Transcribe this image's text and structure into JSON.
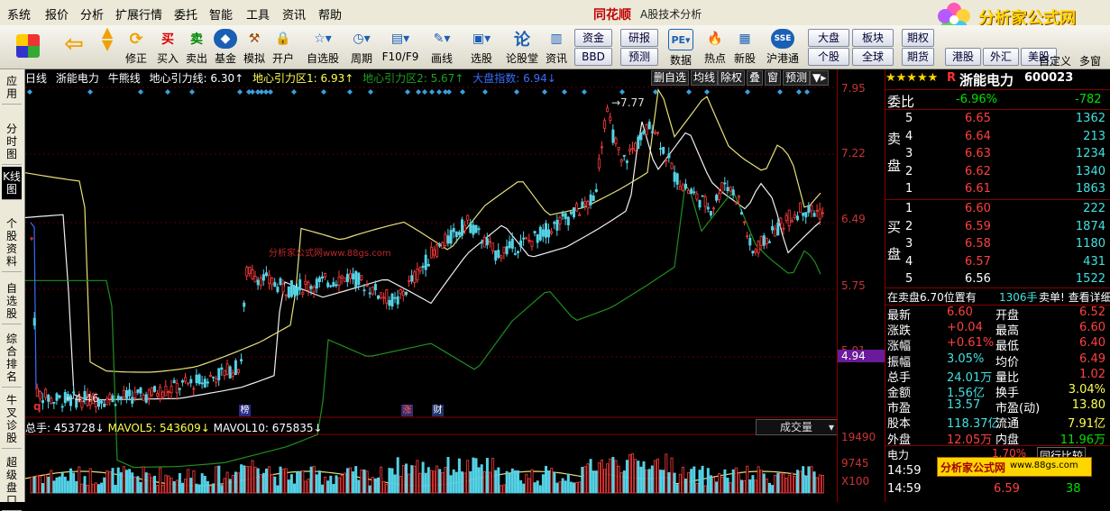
{
  "menu": [
    "系统",
    "报价",
    "分析",
    "扩展行情",
    "委托",
    "智能",
    "工具",
    "资讯",
    "帮助"
  ],
  "brand": "同花顺",
  "window_subtitle": "A股技术分析",
  "logo": {
    "text": "分析家公式网",
    "url": "www.88gs.com"
  },
  "toolbar": {
    "buttons": [
      {
        "label": "",
        "icon": "layout-icon"
      },
      {
        "label": "",
        "icon": "back-arrow-icon"
      },
      {
        "label": "",
        "icon": "updown-arrow-icon"
      },
      {
        "label": "",
        "icon": "refresh-icon"
      },
      {
        "label": "买入",
        "glyph": "买"
      },
      {
        "label": "卖出",
        "glyph": "卖"
      },
      {
        "label": "基金",
        "glyph": "基"
      },
      {
        "label": "模拟",
        "glyph": "模"
      },
      {
        "label": "开户",
        "glyph": "锁"
      },
      {
        "label": "自选股",
        "glyph": "☆"
      },
      {
        "label": "周期",
        "glyph": "◷"
      },
      {
        "label": "F10/F9",
        "glyph": "▤"
      },
      {
        "label": "画线",
        "glyph": "✎"
      },
      {
        "label": "选股",
        "glyph": "▣"
      },
      {
        "label": "论股堂",
        "glyph": "论"
      },
      {
        "label": "资讯",
        "glyph": "资"
      },
      {
        "label": "数据",
        "glyph": "PE"
      },
      {
        "label": "热点",
        "glyph": "热"
      },
      {
        "label": "新股",
        "glyph": "新"
      },
      {
        "label": "沪港通",
        "glyph": "港"
      }
    ],
    "pills": [
      "资金",
      "研报",
      "BBD",
      "预测",
      "大盘",
      "板块",
      "期权",
      "个股",
      "全球",
      "期货",
      "港股",
      "外汇",
      "美股",
      "自定义",
      "多窗"
    ]
  },
  "left_tabs": [
    "应用",
    "分时图",
    "K线图",
    "个股资料",
    "自选股",
    "综合排名",
    "牛叉诊股",
    "超级盘口"
  ],
  "chart_header": {
    "period": "日线",
    "name": "浙能电力",
    "indicator": "牛熊线",
    "line1": "地心引力线: 6.30↑",
    "line2": "地心引力区1: 6.93↑",
    "line3": "地心引力区2: 5.67↑",
    "line4": "大盘指数: 6.94↓"
  },
  "chart_tools": [
    "删自选",
    "均线",
    "除权",
    "叠",
    "窗",
    "预测"
  ],
  "axis_labels": [
    "7.95",
    "7.22",
    "6.49",
    "5.75",
    "5.01",
    "4.94",
    "19490",
    "9745",
    "X100"
  ],
  "price_high": "7.77",
  "price_low": "4.46",
  "markers": [
    "榜",
    "涨",
    "财"
  ],
  "watermark": "分析家公式网www.88gs.com",
  "volume_header": {
    "total": "总手: 453728↓",
    "mavol5": "MAVOL5: 543609↓",
    "mavol10": "MAVOL10: 675835↓"
  },
  "volume_select": "成交量",
  "stock": {
    "stars": "★★★★★",
    "code": "600023",
    "name": "浙能电力",
    "flag": "R"
  },
  "weibi": {
    "label": "委比",
    "pct": "-6.96%",
    "val": "-782"
  },
  "sell": [
    {
      "n": "5",
      "p": "6.65",
      "v": "1362"
    },
    {
      "n": "4",
      "p": "6.64",
      "v": "213"
    },
    {
      "n": "3",
      "p": "6.63",
      "v": "1234"
    },
    {
      "n": "2",
      "p": "6.62",
      "v": "1340"
    },
    {
      "n": "1",
      "p": "6.61",
      "v": "1863"
    }
  ],
  "buy": [
    {
      "n": "1",
      "p": "6.60",
      "v": "222"
    },
    {
      "n": "2",
      "p": "6.59",
      "v": "1874"
    },
    {
      "n": "3",
      "p": "6.58",
      "v": "1180"
    },
    {
      "n": "4",
      "p": "6.57",
      "v": "431"
    },
    {
      "n": "5",
      "p": "6.56",
      "v": "1522"
    }
  ],
  "sell_label": "卖盘",
  "buy_label": "买盘",
  "order_bar": {
    "left": "在卖盘6.70位置有",
    "vol": "1306手",
    "right": "卖单! 查看详细"
  },
  "quote": [
    {
      "k": "最新",
      "v": "6.60",
      "k2": "开盘",
      "v2": "6.52"
    },
    {
      "k": "涨跌",
      "v": "+0.04",
      "k2": "最高",
      "v2": "6.60"
    },
    {
      "k": "涨幅",
      "v": "+0.61%",
      "k2": "最低",
      "v2": "6.40"
    },
    {
      "k": "振幅",
      "v": "3.05%",
      "k2": "均价",
      "v2": "6.49"
    },
    {
      "k": "总手",
      "v": "24.01万",
      "k2": "量比",
      "v2": "1.02"
    },
    {
      "k": "金额",
      "v": "1.56亿",
      "k2": "换手",
      "v2": "3.04%"
    },
    {
      "k": "市盈",
      "v": "13.57",
      "k2": "市盈(动)",
      "v2": "13.80"
    },
    {
      "k": "股本",
      "v": "118.37亿",
      "k2": "流通",
      "v2": "7.91亿"
    },
    {
      "k": "外盘",
      "v": "12.05万",
      "k2": "内盘",
      "v2": "11.96万"
    }
  ],
  "bottom": {
    "sector": "电力",
    "sector_pct": "1.70%",
    "tab": "同行比较",
    "time1": "14:59",
    "time2": "14:59",
    "p2": "6.59",
    "v2": "38"
  }
}
